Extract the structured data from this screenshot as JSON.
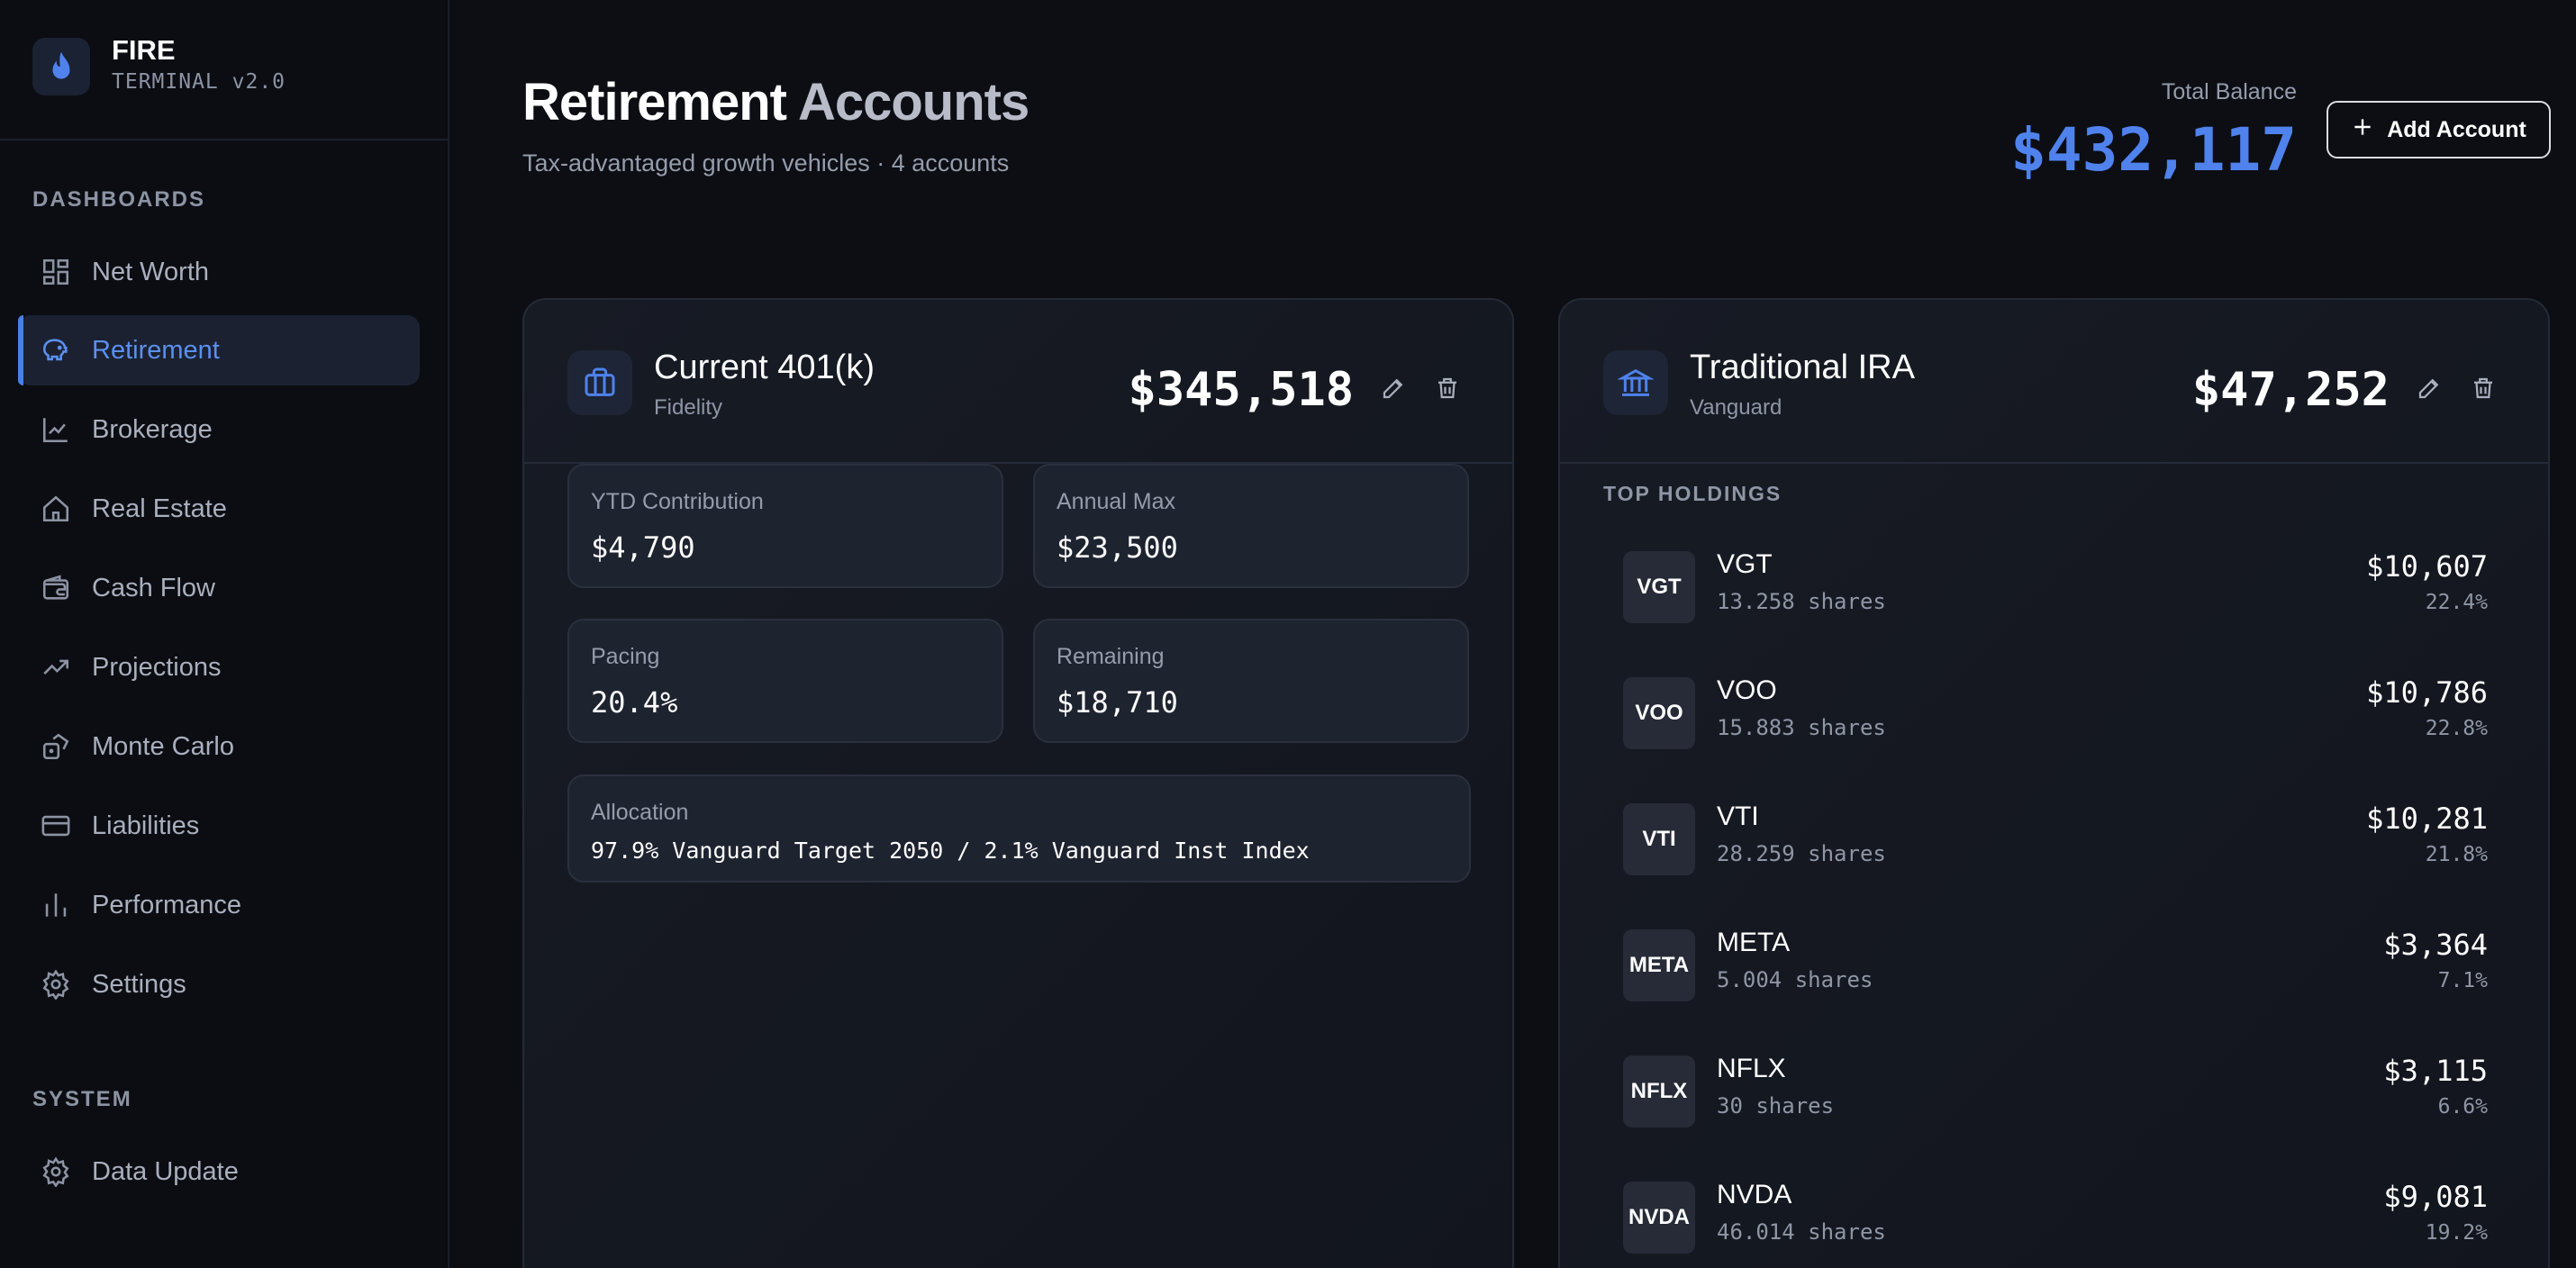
{
  "brand": {
    "name": "FIRE",
    "subtitle": "TERMINAL v2.0"
  },
  "sidebar": {
    "dashboards_label": "DASHBOARDS",
    "items": [
      {
        "label": "Net Worth",
        "icon": "grid-icon"
      },
      {
        "label": "Retirement",
        "icon": "piggy-bank-icon",
        "active": true
      },
      {
        "label": "Brokerage",
        "icon": "line-chart-icon"
      },
      {
        "label": "Real Estate",
        "icon": "home-icon"
      },
      {
        "label": "Cash Flow",
        "icon": "wallet-icon"
      },
      {
        "label": "Projections",
        "icon": "trending-up-icon"
      },
      {
        "label": "Monte Carlo",
        "icon": "dice-icon"
      },
      {
        "label": "Liabilities",
        "icon": "credit-card-icon"
      },
      {
        "label": "Performance",
        "icon": "bar-chart-icon"
      },
      {
        "label": "Settings",
        "icon": "gear-icon"
      }
    ],
    "system_label": "SYSTEM",
    "system_items": [
      {
        "label": "Data Update",
        "icon": "gear-icon"
      }
    ]
  },
  "header": {
    "title_part1": "Retirement",
    "title_part2": "Accounts",
    "subtitle": "Tax-advantaged growth vehicles · 4 accounts",
    "total_label": "Total Balance",
    "total_value": "$432,117",
    "add_button": "Add Account"
  },
  "accounts": [
    {
      "name": "Current 401(k)",
      "institution": "Fidelity",
      "balance": "$345,518",
      "stats": [
        {
          "label": "YTD Contribution",
          "value": "$4,790"
        },
        {
          "label": "Annual Max",
          "value": "$23,500"
        },
        {
          "label": "Pacing",
          "value": "20.4%"
        },
        {
          "label": "Remaining",
          "value": "$18,710"
        }
      ],
      "allocation_label": "Allocation",
      "allocation_value": "97.9% Vanguard Target 2050 / 2.1% Vanguard Inst Index"
    },
    {
      "name": "Traditional IRA",
      "institution": "Vanguard",
      "balance": "$47,252",
      "holdings_label": "TOP HOLDINGS",
      "holdings": [
        {
          "ticker": "VGT",
          "shares": "13.258 shares",
          "value": "$10,607",
          "pct": "22.4%"
        },
        {
          "ticker": "VOO",
          "shares": "15.883 shares",
          "value": "$10,786",
          "pct": "22.8%"
        },
        {
          "ticker": "VTI",
          "shares": "28.259 shares",
          "value": "$10,281",
          "pct": "21.8%"
        },
        {
          "ticker": "META",
          "shares": "5.004 shares",
          "value": "$3,364",
          "pct": "7.1%"
        },
        {
          "ticker": "NFLX",
          "shares": "30 shares",
          "value": "$3,115",
          "pct": "6.6%"
        },
        {
          "ticker": "NVDA",
          "shares": "46.014 shares",
          "value": "$9,081",
          "pct": "19.2%"
        }
      ]
    }
  ],
  "colors": {
    "accent": "#4f82ec",
    "background": "#0c0e14",
    "card": "#171b24"
  }
}
